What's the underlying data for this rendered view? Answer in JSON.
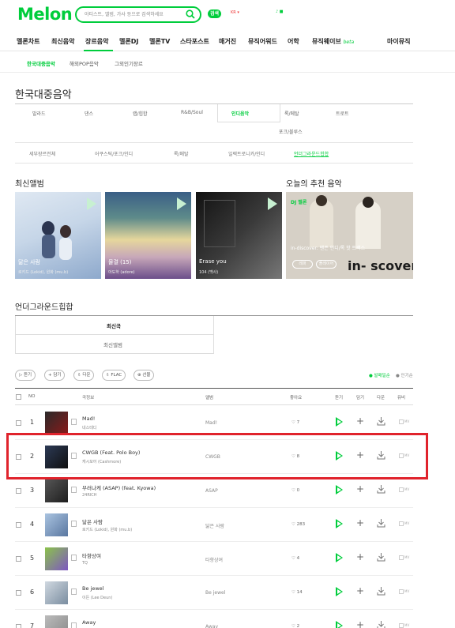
{
  "header": {
    "logo": "Melon",
    "search_placeholder": "아티스트, 앨범, 가사 등으로 검색하세요",
    "badge": "검색",
    "flag_text": "KR ▾",
    "extra": "♪ ■"
  },
  "gnb": {
    "items": [
      "멜론차트",
      "최신음악",
      "장르음악",
      "멜론DJ",
      "멜론TV",
      "스타포스트",
      "매거진",
      "뮤직어워드",
      "어학",
      "뮤직웨이브",
      "마이뮤직"
    ],
    "beta": "beta"
  },
  "subnav": {
    "items": [
      "한국대중음악",
      "해외POP음악",
      "그외인기장르"
    ]
  },
  "page_title": "한국대중음악",
  "genres": {
    "row1": [
      "발라드",
      "댄스",
      "랩/힙합",
      "R&B/Soul",
      "인디음악",
      "록/메탈",
      "트로트"
    ],
    "row2": [
      "포크/블루스"
    ],
    "sub": [
      "세부장르전체",
      "어쿠스틱/포크/인디",
      "록/메탈",
      "일렉트로니카/인디",
      "언더그라운드힙합"
    ]
  },
  "latest": {
    "title": "최신앨범",
    "albums": [
      {
        "title": "닮은 사람",
        "artist": "로키드 (Lokid), 원화 (mu.b)",
        "colors": [
          "#c9d9e8",
          "#7f9fc2"
        ]
      },
      {
        "title": "물결 (15)",
        "artist": "아도하 (adore)",
        "colors": [
          "#2c4d73",
          "#e0cf8a"
        ]
      },
      {
        "title": "Erase you",
        "artist": "104 (백사)",
        "colors": [
          "#1b1b1b",
          "#6c6c6c"
        ]
      }
    ]
  },
  "recommend": {
    "title": "오늘의 추천 음악",
    "dj": "DJ 멜론",
    "desc": "in-discover: 팬픈 인디/록 핫 트랙스",
    "btn1": "레퍼",
    "btn2": "플레이어",
    "big": "in- scover"
  },
  "underground": {
    "title": "언더그라운드힙합",
    "tab_active": "최신곡",
    "tab_other": "최신앨범"
  },
  "buttons": {
    "items": [
      "듣기",
      "담기",
      "다운",
      "FLAC",
      "선물"
    ],
    "sort1": "● 발매일순",
    "sort2": "● 인기순"
  },
  "table": {
    "headers": [
      "NO",
      "곡정보",
      "앨범",
      "좋아요",
      "듣기",
      "담기",
      "다운",
      "뮤비"
    ],
    "rows": [
      {
        "rank": "1",
        "title": "Mad!",
        "artist": "네스테디",
        "album": "Mad!",
        "likes": "♡ 7",
        "c1": "#2a2a2a",
        "c2": "#8b1a1a"
      },
      {
        "rank": "2",
        "title": "CWGB (Feat. Polo Boy)",
        "artist": "캐시모어 (Cashmore)",
        "album": "CWGB",
        "likes": "♡ 8",
        "c1": "#2c3a55",
        "c2": "#101010"
      },
      {
        "rank": "3",
        "title": "부러나케 (ASAP) (feat. Kyowa)",
        "artist": "24RICH",
        "album": "ASAP",
        "likes": "♡ 0",
        "c1": "#555555",
        "c2": "#1e1e1e"
      },
      {
        "rank": "4",
        "title": "닮은 사람",
        "artist": "로키드 (Lokid), 원화 (mu.b)",
        "album": "닮은 사람",
        "likes": "♡ 283",
        "c1": "#a9c3e0",
        "c2": "#5a77a0"
      },
      {
        "rank": "5",
        "title": "타향상여",
        "artist": "TQ",
        "album": "타향상여",
        "likes": "♡ 4",
        "c1": "#8bc34a",
        "c2": "#7e57c2"
      },
      {
        "rank": "6",
        "title": "Be jewel",
        "artist": "이든 (Lee Deun)",
        "album": "Be jewel",
        "likes": "♡ 14",
        "c1": "#d0d8e0",
        "c2": "#7a8da0"
      },
      {
        "rank": "7",
        "title": "Away",
        "artist": "",
        "album": "Away",
        "likes": "♡ 2",
        "c1": "#bbbbbb",
        "c2": "#888888"
      }
    ],
    "mv_label": "MV"
  },
  "colors": {
    "accent": "#00cd3c",
    "highlight": "#e0232c"
  }
}
